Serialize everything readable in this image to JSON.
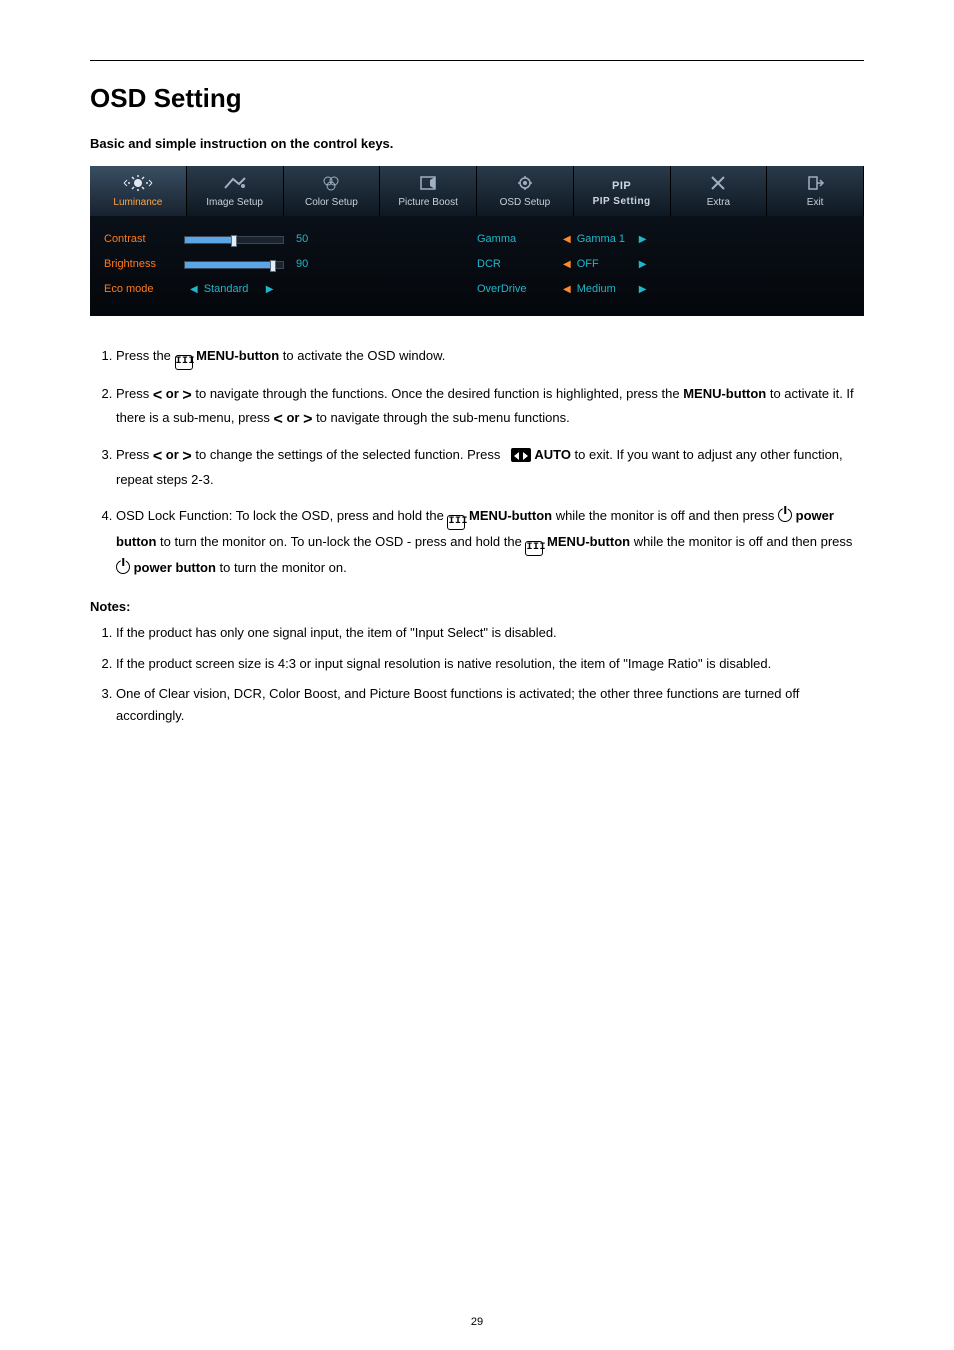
{
  "page": {
    "title": "OSD Setting",
    "subhead": "Basic and simple instruction on the control keys.",
    "notes_heading": "Notes:",
    "page_number": "29"
  },
  "osd": {
    "tabs": [
      {
        "name": "luminance",
        "label": "Luminance",
        "active": true
      },
      {
        "name": "image-setup",
        "label": "Image Setup",
        "active": false
      },
      {
        "name": "color-setup",
        "label": "Color Setup",
        "active": false
      },
      {
        "name": "picture-boost",
        "label": "Picture Boost",
        "active": false
      },
      {
        "name": "osd-setup",
        "label": "OSD Setup",
        "active": false
      },
      {
        "name": "pip-setting",
        "label": "PIP Setting",
        "active": false,
        "pip_top": "PIP"
      },
      {
        "name": "extra",
        "label": "Extra",
        "active": false
      },
      {
        "name": "exit",
        "label": "Exit",
        "active": false
      }
    ],
    "left_block": {
      "contrast": {
        "label": "Contrast",
        "value": "50"
      },
      "brightness": {
        "label": "Brightness",
        "value": "90"
      },
      "eco": {
        "label": "Eco mode",
        "value": "Standard"
      }
    },
    "right_block": {
      "gamma": {
        "label": "Gamma",
        "value": "Gamma 1"
      },
      "dcr": {
        "label": "DCR",
        "value": "OFF"
      },
      "overdrive": {
        "label": "OverDrive",
        "value": "Medium"
      }
    }
  },
  "instructions": {
    "i1_a": "Press the ",
    "i1_b": " MENU-button",
    "i1_c": " to activate the OSD window.",
    "i2_a": "Press ",
    "i2_or": " or ",
    "i2_b": " to navigate through the functions. Once the desired function is highlighted, press the ",
    "i2_menu": "MENU-button",
    "i2_c": " to activate it. If there is a sub-menu, press ",
    "i2_d": " to navigate through the sub-menu functions.",
    "i3_a": "Press ",
    "i3_b": " to change the settings of the selected function. Press ",
    "i3_auto": " AUTO",
    "i3_c": " to exit. If you want to adjust any other function, repeat steps 2-3.",
    "i4_a": "OSD Lock Function: To lock the OSD, press and hold the ",
    "i4_menu1": " MENU-button",
    "i4_b": " while the monitor is off and then press ",
    "i4_power1": " power button",
    "i4_c": " to turn the monitor on. To un-lock the OSD - press and hold the ",
    "i4_menu2": " MENU-button",
    "i4_d": " while the monitor is off and then press ",
    "i4_power2": " power button",
    "i4_e": " to turn the monitor on."
  },
  "notes": {
    "n1": "If the product has only one signal input, the item of \"Input Select\" is disabled.",
    "n2": "If the product screen size is 4:3 or input signal resolution is native resolution, the item of \"Image Ratio\" is disabled.",
    "n3": "One of Clear vision, DCR, Color Boost, and Picture Boost functions is activated; the other three functions are turned off accordingly."
  }
}
